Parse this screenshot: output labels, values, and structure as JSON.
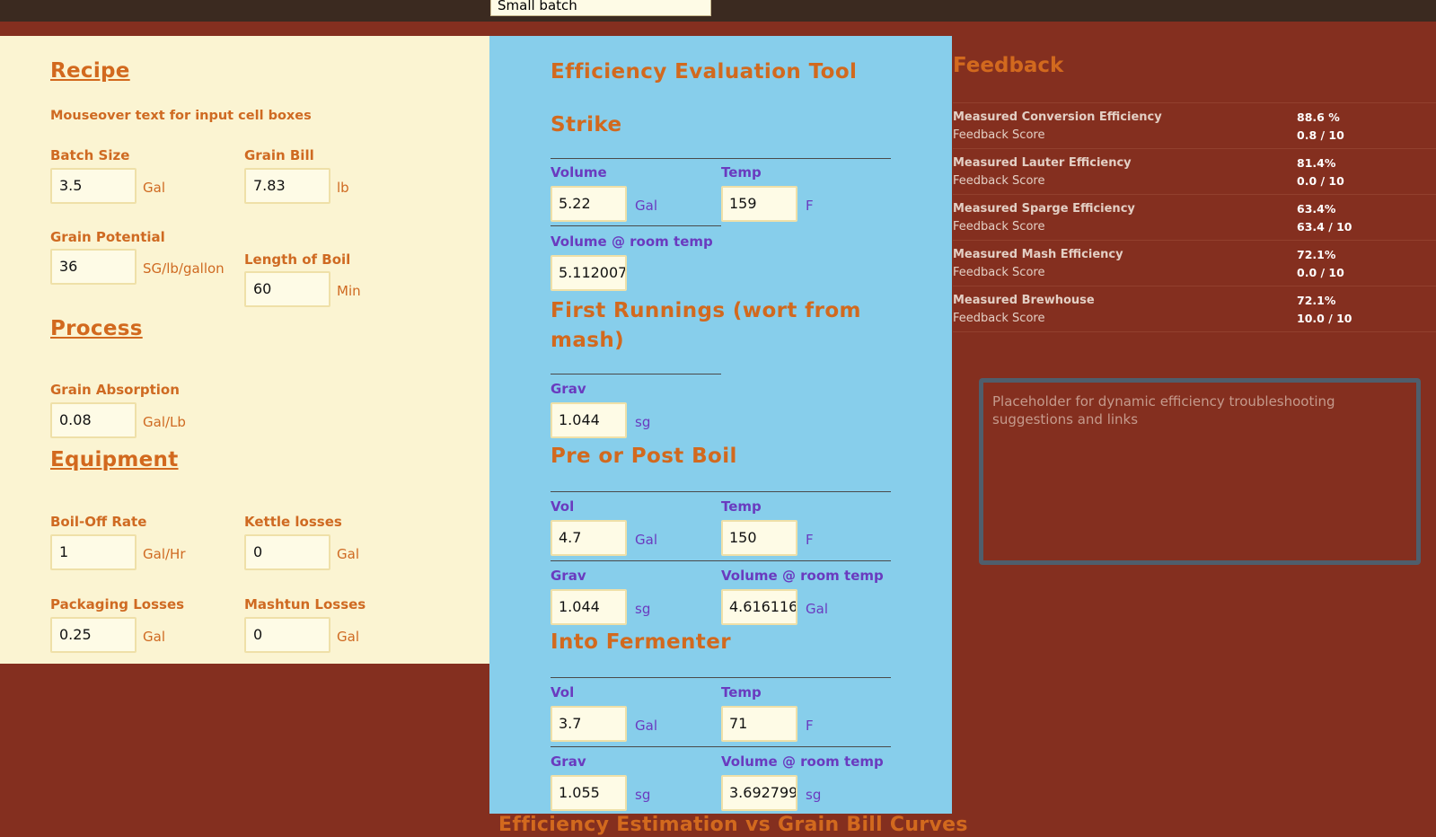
{
  "preset": {
    "value": "Small batch"
  },
  "recipe": {
    "heading": "Recipe",
    "note": "Mouseover text for input cell boxes",
    "batch_size": {
      "label": "Batch Size",
      "value": "3.5",
      "unit": "Gal"
    },
    "grain_bill": {
      "label": "Grain Bill",
      "value": "7.83",
      "unit": "lb"
    },
    "grain_potential": {
      "label": "Grain Potential",
      "value": "36",
      "unit": "SG/lb/gallon"
    },
    "length_of_boil": {
      "label": "Length of Boil",
      "value": "60",
      "unit": "Min"
    }
  },
  "process": {
    "heading": "Process",
    "grain_absorption": {
      "label": "Grain Absorption",
      "value": "0.08",
      "unit": "Gal/Lb"
    }
  },
  "equipment": {
    "heading": "Equipment",
    "boil_off_rate": {
      "label": "Boil-Off Rate",
      "value": "1",
      "unit": "Gal/Hr"
    },
    "kettle_losses": {
      "label": "Kettle losses",
      "value": "0",
      "unit": "Gal"
    },
    "packaging_losses": {
      "label": "Packaging Losses",
      "value": "0.25",
      "unit": "Gal"
    },
    "mashtun_losses": {
      "label": "Mashtun Losses",
      "value": "0",
      "unit": "Gal"
    }
  },
  "tool": {
    "title": "Efficiency Evaluation Tool",
    "strike": {
      "heading": "Strike",
      "volume": {
        "label": "Volume",
        "value": "5.22",
        "unit": "Gal"
      },
      "temp": {
        "label": "Temp",
        "value": "159",
        "unit": "F"
      },
      "volume_room": {
        "label": "Volume @ room temp",
        "value": "5.112007"
      }
    },
    "first_runnings": {
      "heading": "First Runnings (wort from mash)",
      "grav": {
        "label": "Grav",
        "value": "1.044",
        "unit": "sg"
      }
    },
    "boil": {
      "heading": "Pre or Post Boil",
      "vol": {
        "label": "Vol",
        "value": "4.7",
        "unit": "Gal"
      },
      "temp": {
        "label": "Temp",
        "value": "150",
        "unit": "F"
      },
      "grav": {
        "label": "Grav",
        "value": "1.044",
        "unit": "sg"
      },
      "volume_room": {
        "label": "Volume @ room temp",
        "value": "4.616116",
        "unit": "Gal"
      }
    },
    "fermenter": {
      "heading": "Into Fermenter",
      "vol": {
        "label": "Vol",
        "value": "3.7",
        "unit": "Gal"
      },
      "temp": {
        "label": "Temp",
        "value": "71",
        "unit": "F"
      },
      "grav": {
        "label": "Grav",
        "value": "1.055",
        "unit": "sg"
      },
      "volume_room": {
        "label": "Volume @ room temp",
        "value": "3.692799",
        "unit": "sg"
      }
    },
    "next_section": "Efficiency Estimation vs Grain Bill Curves"
  },
  "feedback": {
    "title": "Feedback",
    "rows": [
      {
        "name": "Measured Conversion Efficiency",
        "value": "88.6 %",
        "score_label": "Feedback Score",
        "score": "0.8 / 10"
      },
      {
        "name": "Measured Lauter Efficiency",
        "value": "81.4%",
        "score_label": "Feedback Score",
        "score": "0.0 / 10"
      },
      {
        "name": "Measured Sparge Efficiency",
        "value": "63.4%",
        "score_label": "Feedback Score",
        "score": "63.4 / 10"
      },
      {
        "name": "Measured Mash Efficiency",
        "value": "72.1%",
        "score_label": "Feedback Score",
        "score": "0.0 / 10"
      },
      {
        "name": "Measured Brewhouse",
        "value": "72.1%",
        "score_label": "Feedback Score",
        "score": "10.0 / 10"
      }
    ],
    "suggestions_placeholder": "Placeholder for dynamic efficiency troubleshooting suggestions and links"
  }
}
